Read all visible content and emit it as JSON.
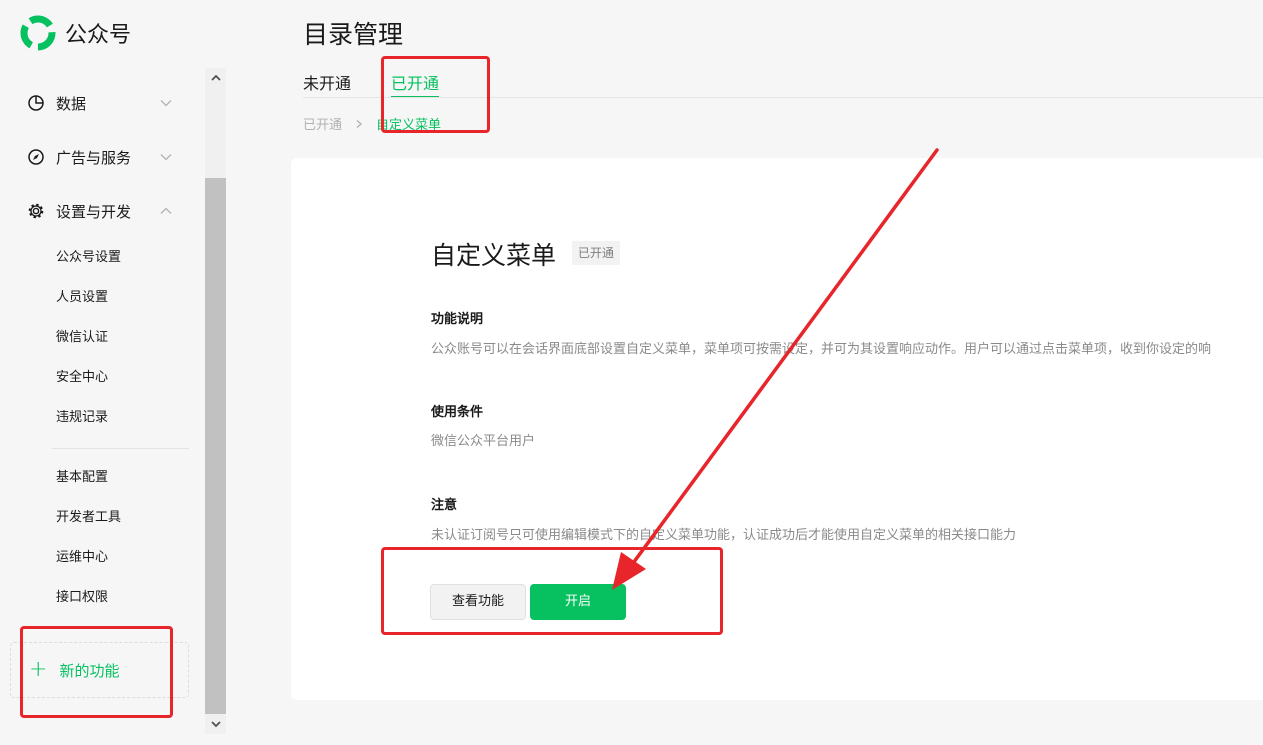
{
  "brand": {
    "name": "公众号",
    "logo_icon": "wechat-official-account-logo",
    "color": "#07c160"
  },
  "sidebar": {
    "groups": [
      {
        "label": "数据",
        "icon": "pie-chart-icon",
        "expanded": false
      },
      {
        "label": "广告与服务",
        "icon": "compass-icon",
        "expanded": false
      },
      {
        "label": "设置与开发",
        "icon": "gear-icon",
        "expanded": true
      }
    ],
    "settings_items": [
      "公众号设置",
      "人员设置",
      "微信认证",
      "安全中心",
      "违规记录"
    ],
    "dev_items": [
      "基本配置",
      "开发者工具",
      "运维中心",
      "接口权限"
    ],
    "new_feature": {
      "plus": "+",
      "label": "新的功能"
    }
  },
  "main": {
    "page_title": "目录管理",
    "tabs": [
      {
        "label": "未开通",
        "active": false
      },
      {
        "label": "已开通",
        "active": true
      }
    ],
    "breadcrumb": [
      "已开通",
      "自定义菜单"
    ],
    "card": {
      "title": "自定义菜单",
      "status_badge": "已开通",
      "sections": [
        {
          "title": "功能说明",
          "text": "公众账号可以在会话界面底部设置自定义菜单，菜单项可按需设定，并可为其设置响应动作。用户可以通过点击菜单项，收到你设定的响"
        },
        {
          "title": "使用条件",
          "text": "微信公众平台用户"
        },
        {
          "title": "注意",
          "text": "未认证订阅号只可使用编辑模式下的自定义菜单功能，认证成功后才能使用自定义菜单的相关接口能力"
        }
      ],
      "buttons": {
        "view": "查看功能",
        "enable": "开启"
      }
    }
  },
  "colors": {
    "accent": "#07c160",
    "annotation": "#e8252a",
    "background": "#f6f6f6",
    "card": "#ffffff"
  }
}
